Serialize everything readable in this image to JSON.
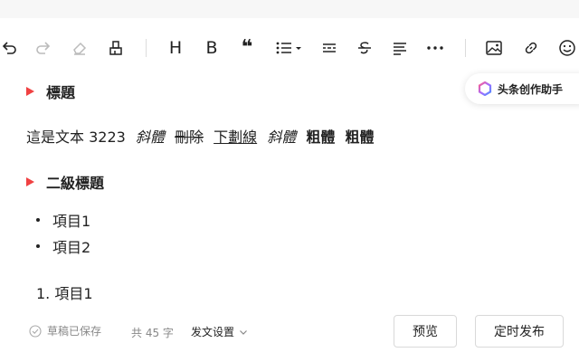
{
  "toolbar": {
    "tools": [
      {
        "name": "undo-icon"
      },
      {
        "name": "redo-icon"
      },
      {
        "name": "eraser-icon"
      },
      {
        "name": "format-painter-icon"
      },
      {
        "name": "heading-icon",
        "label": "H"
      },
      {
        "name": "bold-icon",
        "label": "B"
      },
      {
        "name": "quote-icon",
        "label": "❝"
      },
      {
        "name": "list-icon"
      },
      {
        "name": "divider-icon"
      },
      {
        "name": "strikethrough-icon"
      },
      {
        "name": "align-icon"
      },
      {
        "name": "more-icon"
      },
      {
        "name": "image-icon"
      },
      {
        "name": "link-icon"
      },
      {
        "name": "emoji-icon"
      }
    ]
  },
  "assistant": {
    "label": "头条创作助手"
  },
  "content": {
    "heading1": "標題",
    "paragraph": {
      "plain": "這是文本 3223",
      "italic1": "斜體",
      "strike": "刪除",
      "underline": "下劃線",
      "italic2": "斜體",
      "bold1": "粗體",
      "bold2": "粗體"
    },
    "heading2": "二級標題",
    "bullets": [
      "項目1",
      "項目2"
    ],
    "ordered": [
      "1. 項目1"
    ]
  },
  "footer": {
    "saved_status": "草稿已保存",
    "word_count": "共 45 字",
    "publish_settings": "发文设置",
    "preview_button": "预览",
    "schedule_button": "定时发布"
  },
  "colors": {
    "heading_marker": "#f04142",
    "muted_text": "#888888",
    "border": "#d9d9d9"
  }
}
